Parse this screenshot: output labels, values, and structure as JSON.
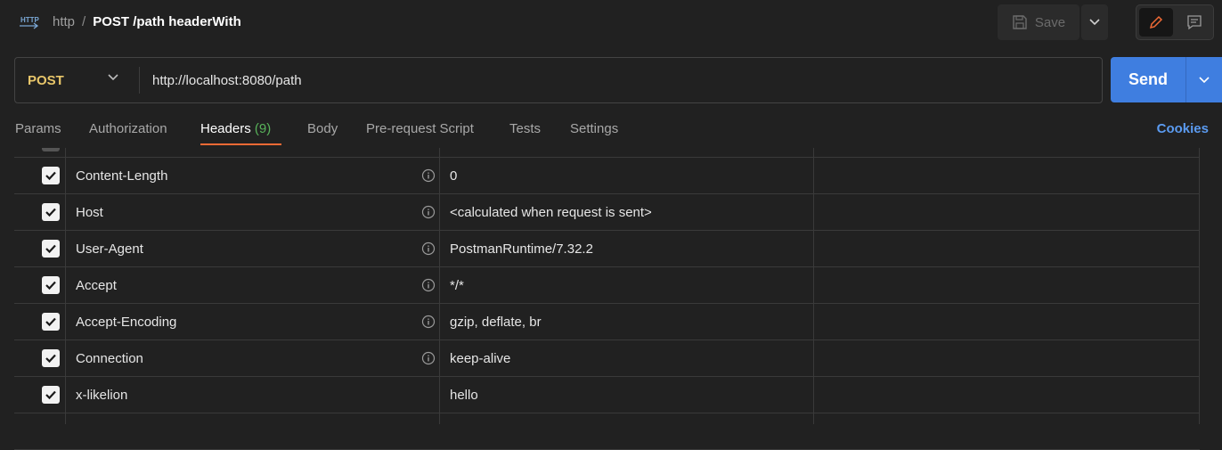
{
  "header": {
    "breadcrumb_root": "http",
    "separator": "/",
    "request_title": "POST /path headerWith",
    "save_label": "Save"
  },
  "request": {
    "method": "POST",
    "url": "http://localhost:8080/path",
    "send_label": "Send"
  },
  "tabs": [
    {
      "label": "Params",
      "count": ""
    },
    {
      "label": "Authorization",
      "count": ""
    },
    {
      "label": "Headers",
      "count": "(9)"
    },
    {
      "label": "Body",
      "count": ""
    },
    {
      "label": "Pre-request Script",
      "count": ""
    },
    {
      "label": "Tests",
      "count": ""
    },
    {
      "label": "Settings",
      "count": ""
    }
  ],
  "active_tab": "Headers",
  "cookies_label": "Cookies",
  "headers": [
    {
      "checked": true,
      "key": "Content-Length",
      "value": "0"
    },
    {
      "checked": true,
      "key": "Host",
      "value": "<calculated when request is sent>"
    },
    {
      "checked": true,
      "key": "User-Agent",
      "value": "PostmanRuntime/7.32.2"
    },
    {
      "checked": true,
      "key": "Accept",
      "value": "*/*"
    },
    {
      "checked": true,
      "key": "Accept-Encoding",
      "value": "gzip, deflate, br"
    },
    {
      "checked": true,
      "key": "Connection",
      "value": "keep-alive"
    },
    {
      "checked": true,
      "key": "x-likelion",
      "value": "hello"
    }
  ],
  "colors": {
    "method": "#e8c66a",
    "send": "#3f7ee0",
    "tab_underline": "#f06a35",
    "count": "#58b35a",
    "cookies": "#5b9bf0"
  }
}
